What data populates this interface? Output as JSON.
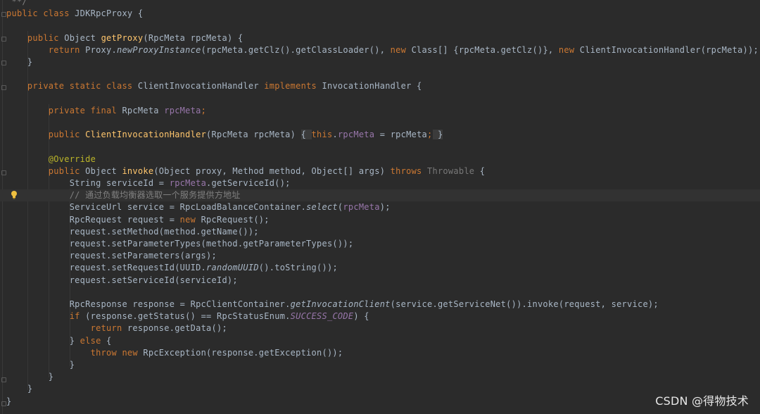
{
  "editor": {
    "language": "Java",
    "lines": [
      {
        "tokens": [
          [
            "c",
            " **/"
          ]
        ]
      },
      {
        "tokens": [
          [
            "k",
            "public class "
          ],
          [
            "t",
            "JDKRpcProxy {"
          ]
        ]
      },
      {
        "tokens": []
      },
      {
        "tokens": [
          [
            "t",
            "    "
          ],
          [
            "k",
            "public "
          ],
          [
            "t",
            "Object "
          ],
          [
            "f",
            "getProxy"
          ],
          [
            "t",
            "(RpcMeta rpcMeta) {"
          ]
        ]
      },
      {
        "tokens": [
          [
            "t",
            "        "
          ],
          [
            "k",
            "return "
          ],
          [
            "t",
            "Proxy."
          ],
          [
            "i",
            "newProxyInstance"
          ],
          [
            "t",
            "(rpcMeta.getClz().getClassLoader(), "
          ],
          [
            "k",
            "new "
          ],
          [
            "t",
            "Class[] {rpcMeta.getClz()}, "
          ],
          [
            "k",
            "new "
          ],
          [
            "t",
            "ClientInvocationHandler(rpcMeta));"
          ]
        ]
      },
      {
        "tokens": [
          [
            "t",
            "    }"
          ]
        ]
      },
      {
        "tokens": []
      },
      {
        "tokens": [
          [
            "t",
            "    "
          ],
          [
            "k",
            "private static class "
          ],
          [
            "t",
            "ClientInvocationHandler "
          ],
          [
            "k",
            "implements "
          ],
          [
            "t",
            "InvocationHandler {"
          ]
        ]
      },
      {
        "tokens": []
      },
      {
        "tokens": [
          [
            "t",
            "        "
          ],
          [
            "k",
            "private final "
          ],
          [
            "t",
            "RpcMeta "
          ],
          [
            "v",
            "rpcMeta"
          ],
          [
            "k",
            ";"
          ]
        ]
      },
      {
        "tokens": []
      },
      {
        "tokens": [
          [
            "t",
            "        "
          ],
          [
            "k",
            "public "
          ],
          [
            "f",
            "ClientInvocationHandler"
          ],
          [
            "t",
            "(RpcMeta rpcMeta) "
          ],
          [
            "b",
            "{ "
          ],
          [
            "k",
            "this"
          ],
          [
            "t",
            "."
          ],
          [
            "v",
            "rpcMeta"
          ],
          [
            "t",
            " = rpcMeta"
          ],
          [
            "k",
            ";"
          ],
          [
            "b",
            " }"
          ]
        ]
      },
      {
        "tokens": []
      },
      {
        "tokens": [
          [
            "t",
            "        "
          ],
          [
            "a",
            "@Override"
          ]
        ]
      },
      {
        "tokens": [
          [
            "t",
            "        "
          ],
          [
            "k",
            "public "
          ],
          [
            "t",
            "Object "
          ],
          [
            "f",
            "invoke"
          ],
          [
            "t",
            "(Object proxy, Method method, Object[] args) "
          ],
          [
            "k",
            "throws "
          ],
          [
            "g",
            "Throwable"
          ],
          [
            "t",
            " {"
          ]
        ]
      },
      {
        "tokens": [
          [
            "t",
            "            String serviceId = "
          ],
          [
            "v",
            "rpcMeta"
          ],
          [
            "t",
            ".getServiceId();"
          ]
        ]
      },
      {
        "tokens": [
          [
            "t",
            "            "
          ],
          [
            "c",
            "// 通过负载均衡器选取一个服务提供方地址"
          ]
        ],
        "highlight": true
      },
      {
        "tokens": [
          [
            "t",
            "            ServiceUrl service = RpcLoadBalanceContainer."
          ],
          [
            "i",
            "select"
          ],
          [
            "t",
            "("
          ],
          [
            "v",
            "rpcMeta"
          ],
          [
            "t",
            ");"
          ]
        ]
      },
      {
        "tokens": [
          [
            "t",
            "            RpcRequest request = "
          ],
          [
            "k",
            "new "
          ],
          [
            "t",
            "RpcRequest();"
          ]
        ]
      },
      {
        "tokens": [
          [
            "t",
            "            request.setMethod(method.getName());"
          ]
        ]
      },
      {
        "tokens": [
          [
            "t",
            "            request.setParameterTypes(method.getParameterTypes());"
          ]
        ]
      },
      {
        "tokens": [
          [
            "t",
            "            request.setParameters(args);"
          ]
        ]
      },
      {
        "tokens": [
          [
            "t",
            "            request.setRequestId(UUID."
          ],
          [
            "i",
            "randomUUID"
          ],
          [
            "t",
            "().toString());"
          ]
        ]
      },
      {
        "tokens": [
          [
            "t",
            "            request.setServiceId(serviceId);"
          ]
        ]
      },
      {
        "tokens": []
      },
      {
        "tokens": [
          [
            "t",
            "            RpcResponse response = RpcClientContainer."
          ],
          [
            "i",
            "getInvocationClient"
          ],
          [
            "t",
            "(service.getServiceNet()).invoke(request, service);"
          ]
        ]
      },
      {
        "tokens": [
          [
            "t",
            "            "
          ],
          [
            "k",
            "if "
          ],
          [
            "t",
            "(response.getStatus() == RpcStatusEnum."
          ],
          [
            "s",
            "SUCCESS_CODE"
          ],
          [
            "t",
            ") {"
          ]
        ]
      },
      {
        "tokens": [
          [
            "t",
            "                "
          ],
          [
            "k",
            "return "
          ],
          [
            "t",
            "response.getData();"
          ]
        ]
      },
      {
        "tokens": [
          [
            "t",
            "            } "
          ],
          [
            "k",
            "else "
          ],
          [
            "t",
            "{"
          ]
        ]
      },
      {
        "tokens": [
          [
            "t",
            "                "
          ],
          [
            "k",
            "throw new "
          ],
          [
            "t",
            "RpcException(response.getException());"
          ]
        ]
      },
      {
        "tokens": [
          [
            "t",
            "            }"
          ]
        ]
      },
      {
        "tokens": [
          [
            "t",
            "        }"
          ]
        ]
      },
      {
        "tokens": [
          [
            "t",
            "    }"
          ]
        ]
      },
      {
        "tokens": [
          [
            "t",
            "}"
          ]
        ]
      }
    ]
  },
  "gutter": {
    "intention_icon": "lightbulb-icon"
  },
  "colors": {
    "background": "#2b2b2b",
    "keyword": "#cc7832",
    "function": "#ffc66d",
    "field": "#9876aa",
    "annotation": "#bbb529",
    "comment": "#808080",
    "text": "#a9b7c6",
    "bulb": "#f0c040"
  },
  "watermark": {
    "text": "CSDN @得物技术"
  }
}
